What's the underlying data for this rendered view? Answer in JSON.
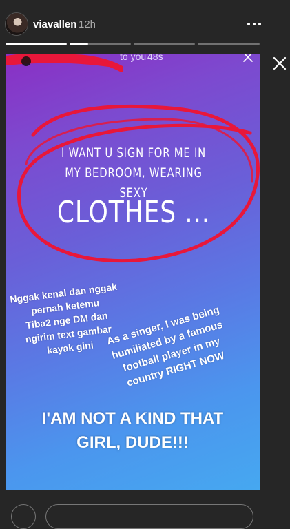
{
  "header": {
    "username": "viavallen",
    "time": "12h"
  },
  "story": {
    "reply_header": {
      "label": "to you",
      "age": "48s"
    },
    "message_line1": "I WANT U SIGN FOR ME IN MY BEDROOM, WEARING SEXY",
    "message_line2": "CLOTHES ...",
    "note_indonesian": [
      "Nggak kenal dan nggak",
      "pernah ketemu",
      "Tiba2 nge DM dan",
      "ngirim text gambar",
      "kayak gini"
    ],
    "note_english": [
      "As a singer, I was being",
      "humiliated by a famous",
      "football player in my",
      "country RIGHT NOW"
    ],
    "shout": [
      "I'AM NOT A KIND THAT",
      "GIRL, DUDE!!!"
    ]
  },
  "progress": {
    "segments": 4,
    "current_index": 1,
    "current_fraction": 0.3
  },
  "colors": {
    "background": "#262626",
    "gradient_top": "#8a2fc4",
    "gradient_bottom": "#46a8f0",
    "annotation_red": "#e8173a"
  },
  "icons": [
    "more-icon",
    "close-icon",
    "avatar"
  ]
}
